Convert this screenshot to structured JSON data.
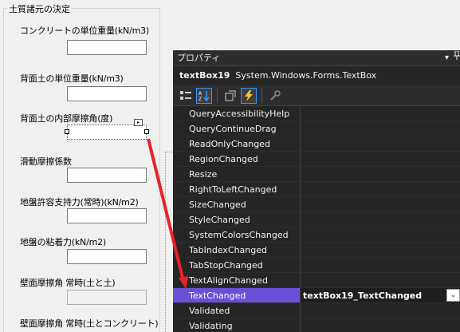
{
  "form": {
    "group_title": "土質諸元の決定",
    "labels": [
      "コンクリートの単位重量(kN/m3)",
      "背面土の単位重量(kN/m3)",
      "背面土の内部摩擦角(度)",
      "滑動摩擦係数",
      "地盤許容支持力(常時)(kN/m2)",
      "地盤の粘着力(kN/m2)",
      "壁面摩擦角 常時(土と土)",
      "壁面摩擦角 常時(土とコンクリート)"
    ],
    "smart_tag_glyph": "▸"
  },
  "properties": {
    "title": "プロパティ",
    "pin_glyph": "▾",
    "object_name": "textBox19",
    "object_type": "System.Windows.Forms.TextBox",
    "events": [
      {
        "name": "QueryAccessibilityHelp",
        "value": ""
      },
      {
        "name": "QueryContinueDrag",
        "value": ""
      },
      {
        "name": "ReadOnlyChanged",
        "value": ""
      },
      {
        "name": "RegionChanged",
        "value": ""
      },
      {
        "name": "Resize",
        "value": ""
      },
      {
        "name": "RightToLeftChanged",
        "value": ""
      },
      {
        "name": "SizeChanged",
        "value": ""
      },
      {
        "name": "StyleChanged",
        "value": ""
      },
      {
        "name": "SystemColorsChanged",
        "value": ""
      },
      {
        "name": "TabIndexChanged",
        "value": ""
      },
      {
        "name": "TabStopChanged",
        "value": ""
      },
      {
        "name": "TextAlignChanged",
        "value": ""
      },
      {
        "name": "TextChanged",
        "value": "textBox19_TextChanged"
      },
      {
        "name": "Validated",
        "value": ""
      },
      {
        "name": "Validating",
        "value": ""
      }
    ],
    "selected_event": "TextChanged",
    "dropdown_glyph": "⌄"
  },
  "colors": {
    "selection_purple": "#6950d6",
    "annotation_arrow": "#e8232a",
    "panel_dark": "#252526"
  }
}
